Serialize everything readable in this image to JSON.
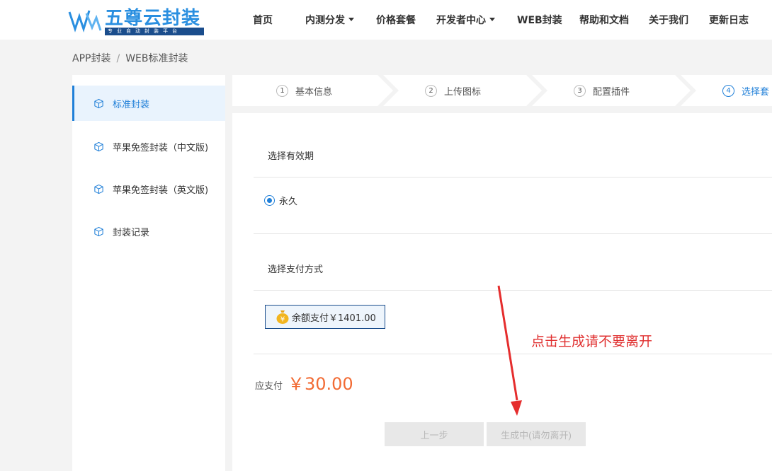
{
  "header": {
    "logo_title": "五尊云封装",
    "logo_subtitle": "专业自动封装平台",
    "nav": [
      {
        "label": "首页",
        "dropdown": false
      },
      {
        "label": "内测分发",
        "dropdown": true
      },
      {
        "label": "价格套餐",
        "dropdown": false
      },
      {
        "label": "开发者中心",
        "dropdown": true
      },
      {
        "label": "WEB封装",
        "dropdown": false
      },
      {
        "label": "帮助和文档",
        "dropdown": false
      },
      {
        "label": "关于我们",
        "dropdown": false
      },
      {
        "label": "更新日志",
        "dropdown": false
      }
    ]
  },
  "breadcrumb": {
    "items": [
      "APP封装",
      "WEB标准封装"
    ],
    "separator": "/"
  },
  "sidebar": {
    "items": [
      {
        "label": "标准封装",
        "icon": "cube-icon",
        "active": true
      },
      {
        "label": "苹果免签封装（中文版)",
        "icon": "cube-icon",
        "active": false
      },
      {
        "label": "苹果免签封装（英文版)",
        "icon": "cube-icon",
        "active": false
      },
      {
        "label": "封装记录",
        "icon": "cube-icon",
        "active": false
      }
    ]
  },
  "steps": [
    {
      "num": "1",
      "label": "基本信息",
      "active": false
    },
    {
      "num": "2",
      "label": "上传图标",
      "active": false
    },
    {
      "num": "3",
      "label": "配置插件",
      "active": false
    },
    {
      "num": "4",
      "label": "选择套",
      "active": true
    }
  ],
  "validity": {
    "title": "选择有效期",
    "option": "永久",
    "selected": true
  },
  "payment": {
    "title": "选择支付方式",
    "method_label": "余额支付￥1401.00",
    "coin_glyph": "¥"
  },
  "total": {
    "label": "应支付",
    "value": "￥30.00"
  },
  "buttons": {
    "prev": "上一步",
    "generate": "生成中(请勿离开)"
  },
  "annotation": {
    "note": "点击生成请不要离开"
  },
  "colors": {
    "accent": "#1f7fd8",
    "price": "#f26b34",
    "annotation": "#e03030",
    "logo": "#2a8fe0"
  }
}
